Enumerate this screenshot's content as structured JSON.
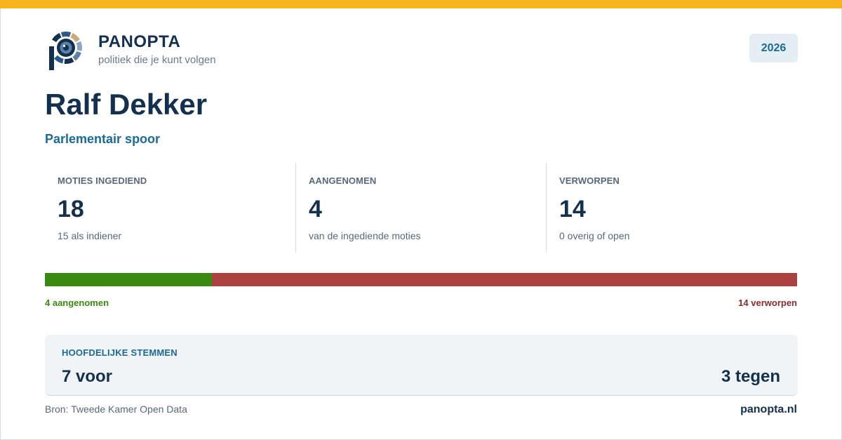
{
  "header": {
    "brand": "PANOPTA",
    "tagline": "politiek die je kunt volgen",
    "year": "2026",
    "logo_icon": "eye-icon"
  },
  "profile": {
    "name": "Ralf Dekker",
    "track": "Parlementair spoor"
  },
  "stats": [
    {
      "label": "MOTIES INGEDIEND",
      "value": "18",
      "note": "15 als indiener"
    },
    {
      "label": "AANGENOMEN",
      "value": "4",
      "note": "van de ingediende moties"
    },
    {
      "label": "VERWORPEN",
      "value": "14",
      "note": "0 overig of open"
    }
  ],
  "outcome_bar": {
    "accepted": 4,
    "rejected": 14,
    "accepted_label": "4 aangenomen",
    "rejected_label": "14 verworpen",
    "accepted_color": "#3a8a12",
    "rejected_color": "#ab4141"
  },
  "votes": {
    "title": "HOOFDELIJKE STEMMEN",
    "for_label": "7 voor",
    "against_label": "3 tegen"
  },
  "footer": {
    "source": "Bron: Tweede Kamer Open Data",
    "site": "panopta.nl"
  },
  "colors": {
    "accent_top": "#f6b51d",
    "primary": "#14304f",
    "link": "#1a6a95"
  }
}
